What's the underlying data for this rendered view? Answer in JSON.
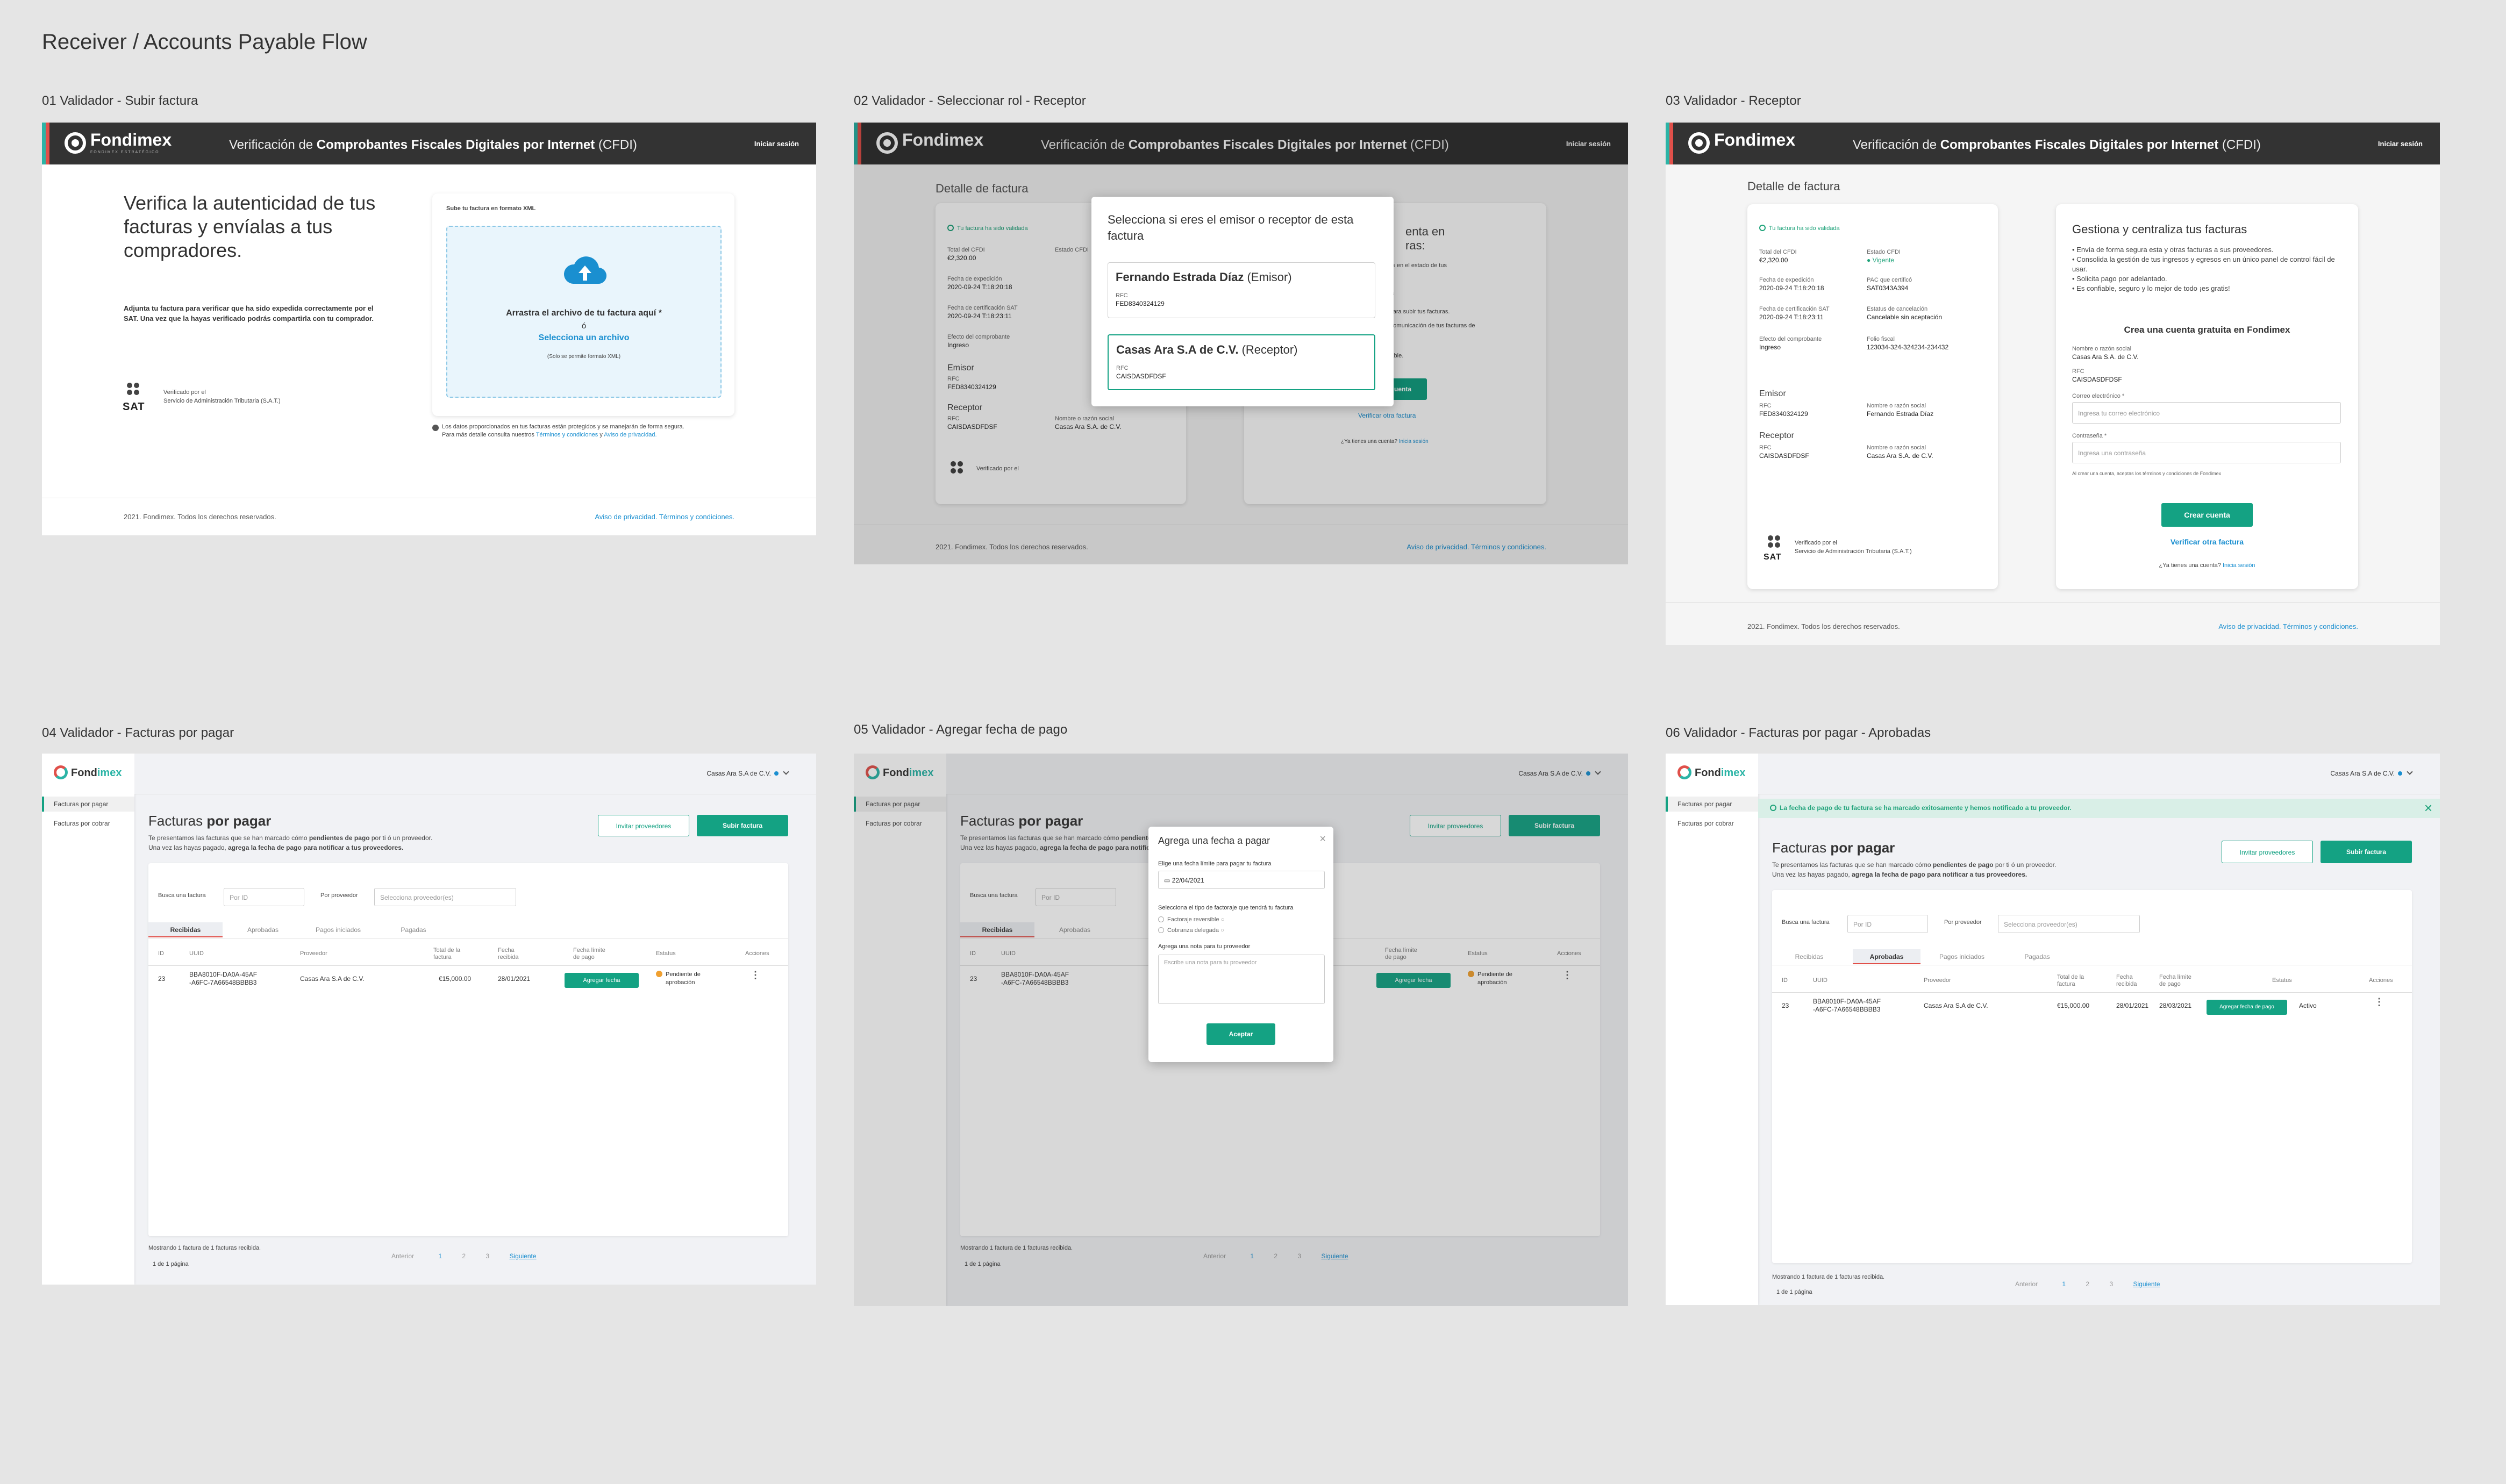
{
  "board_title": "Receiver / Accounts Payable Flow",
  "frames": [
    "01 Validador - Subir factura",
    "02 Validador - Seleccionar rol - Receptor",
    "03 Validador - Receptor",
    "04 Validador - Facturas por pagar",
    "05 Validador - Agregar fecha de pago",
    "06 Validador - Facturas por pagar - Aprobadas"
  ],
  "header": {
    "brand": "Fondimex",
    "brand_sub": "FONDIMEX ESTRATÉGICO",
    "title_prefix": "Verificación de",
    "title_bold": "Comprobantes Fiscales Digitales por Internet",
    "title_suffix": "(CFDI)",
    "login": "Iniciar sesión"
  },
  "upload": {
    "hero": "Verifica la autenticidad de tus facturas y envíalas a tus compradores.",
    "description": "Adjunta tu factura para verificar que ha sido expedida correctamente por el SAT. Una vez que la hayas verificado podrás compartirla con tu comprador.",
    "card_title": "Sube tu factura en formato XML",
    "drop_text": "Arrastra el archivo de tu factura aquí *",
    "or": "ó",
    "select_link": "Selecciona un archivo",
    "only_xml": "(Solo se permite formato XML)",
    "privacy_note_1": "Los datos proporcionados en tus facturas están protegidos y se manejarán de forma segura.",
    "privacy_note_2": "Para más detalle consulta nuestros",
    "terms_link": "Términos y condiciones",
    "and": "y",
    "privacy_link": "Aviso de privacidad."
  },
  "sat": {
    "word": "SAT",
    "verified_1": "Verificado por el",
    "verified_2": "Servicio de Administración Tributaria (S.A.T.)"
  },
  "footer": {
    "copyright": "2021. Fondimex. Todos los derechos reservados.",
    "links": "Aviso de privacidad. Términos y condiciones."
  },
  "detail": {
    "title": "Detalle de factura",
    "validated": "Tu factura ha sido validada",
    "total_label": "Total del CFDI",
    "total_value": "€2,320.00",
    "estado_label": "Estado CFDI",
    "estado_value": "Vigente",
    "exp_label": "Fecha de expedición",
    "exp_value": "2020-09-24 T:18:20:18",
    "pac_label": "PAC que certificó",
    "pac_value": "SAT0343A394",
    "cert_label": "Fecha de certificación SAT",
    "cert_value": "2020-09-24 T:18:23:11",
    "cancel_label": "Estatus de cancelación",
    "cancel_value": "Cancelable sin aceptación",
    "efecto_label": "Efecto del comprobante",
    "efecto_value": "Ingreso",
    "folio_label": "Folio fiscal",
    "folio_value": "123034-324-324234-234432",
    "emisor_title": "Emisor",
    "emisor_rfc_label": "RFC",
    "emisor_rfc": "FED8340324129",
    "emisor_name_label": "Nombre o razón social",
    "emisor_name": "Fernando Estrada Díaz",
    "receptor_title": "Receptor",
    "receptor_rfc_label": "RFC",
    "receptor_rfc": "CAISDASDFDSF",
    "receptor_name_label": "Nombre o razón social",
    "receptor_name": "Casas Ara S.A. de C.V."
  },
  "role_modal": {
    "title": "Selecciona si eres el emisor o receptor de esta factura",
    "opt1_name": "Fernando Estrada Díaz",
    "opt1_role": "(Emisor)",
    "opt1_rfc_label": "RFC",
    "opt1_rfc": "FED8340324129",
    "opt2_name": "Casas Ara S.A de C.V.",
    "opt2_role": "(Receptor)",
    "opt2_rfc_label": "RFC",
    "opt2_rfc": "CAISDASDFDSF"
  },
  "frame2_bg": {
    "right_title_1": "enta en",
    "right_title_2": "ras:",
    "right_line_1": "cambios en el estado de tus",
    "right_line_2": "facturas",
    "right_line_3": "uenta para subir tus facturas.",
    "right_line_4": "ción y comunicación de tus facturas de",
    "right_line_5": "y amigable.",
    "right_btn": "uenta",
    "right_verify": "Verificar otra factura",
    "right_login_q": "¿Ya tienes una cuenta?",
    "right_login": "Inicia sesión"
  },
  "manage": {
    "title": "Gestiona y centraliza tus facturas",
    "bullets": [
      "• Envía de forma segura esta y otras facturas a sus proveedores.",
      "• Consolida la gestión de tus ingresos y egresos en un único panel de control fácil de usar.",
      "• Solicita pago por adelantado.",
      "• Es confiable, seguro y lo mejor de todo ¡es gratis!"
    ],
    "create_title": "Crea una cuenta gratuita en Fondimex",
    "name_label": "Nombre o razón social",
    "name_value": "Casas Ara S.A. de C.V.",
    "rfc_label": "RFC",
    "rfc_value": "CAISDASDFDSF",
    "email_label": "Correo electrónico *",
    "email_placeholder": "Ingresa tu correo electrónico",
    "pass_label": "Contraseña *",
    "pass_placeholder": "Ingresa una contraseña",
    "accept_note": "Al crear una cuenta, aceptas los términos y condiciones de Fondimex",
    "create_btn": "Crear cuenta",
    "verify_link": "Verificar otra factura",
    "login_q": "¿Ya tienes una cuenta?",
    "login_link": "Inicia sesión"
  },
  "dash": {
    "brand_a": "Fond",
    "brand_b": "imex",
    "account": "Casas Ara S.A de C.V.",
    "side_items": [
      "Facturas por pagar",
      "Facturas por cobrar"
    ],
    "title_light": "Facturas",
    "title_bold": "por pagar",
    "desc_1_a": "Te presentamos las facturas que se han marcado cómo",
    "desc_1_b": "pendientes de pago",
    "desc_1_c": "por ti ó un proveedor.",
    "desc_2_a": "Una vez las hayas pagado,",
    "desc_2_b": "agrega la fecha de pago para notificar a tus proveedores.",
    "invite_btn": "Invitar proveedores",
    "upload_btn": "Subir factura",
    "search_label": "Busca una factura",
    "search_placeholder": "Por ID",
    "provider_label": "Por proveedor",
    "provider_placeholder": "Selecciona proveedor(es)",
    "tabs": [
      "Recibidas",
      "Aprobadas",
      "Pagos iniciados",
      "Pagadas"
    ],
    "columns": [
      "ID",
      "UUID",
      "Proveedor",
      "Total de la factura",
      "Fecha recibida",
      "Fecha límite de pago",
      "Estatus",
      "Acciones"
    ],
    "row": {
      "id": "23",
      "uuid_1": "BBA8010F-DA0A-45AF",
      "uuid_2": "-A6FC-7A66548BBBB3",
      "provider": "Casas Ara S.A de C.V.",
      "total": "€15,000.00",
      "date": "28/01/2021",
      "action": "Agregar fecha",
      "status_1": "Pendiente de",
      "status_2": "aprobación"
    },
    "showing": "Mostrando 1 factura de 1 facturas recibida.",
    "page_of": "1 de 1 página",
    "prev": "Anterior",
    "pages": [
      "1",
      "2",
      "3"
    ],
    "next": "Siguiente"
  },
  "date_modal": {
    "title": "Agrega una fecha a pagar",
    "date_label": "Elige una fecha límite para pagar tu factura",
    "date_value": "22/04/2021",
    "type_label": "Selecciona el tipo de factoraje que tendrá tu factura",
    "type_1": "Factoraje reversible",
    "type_2": "Cobranza delegada",
    "note_label": "Agrega una nota para tu proveedor",
    "note_placeholder": "Escribe una nota para tu proveedor",
    "accept": "Aceptar"
  },
  "approved": {
    "toast": "La fecha de pago de tu factura se ha marcado exitosamente y hemos notificado a tu proveedor.",
    "row_limit": "28/03/2021",
    "row_action": "Agregar fecha de pago",
    "row_status": "Activo"
  }
}
